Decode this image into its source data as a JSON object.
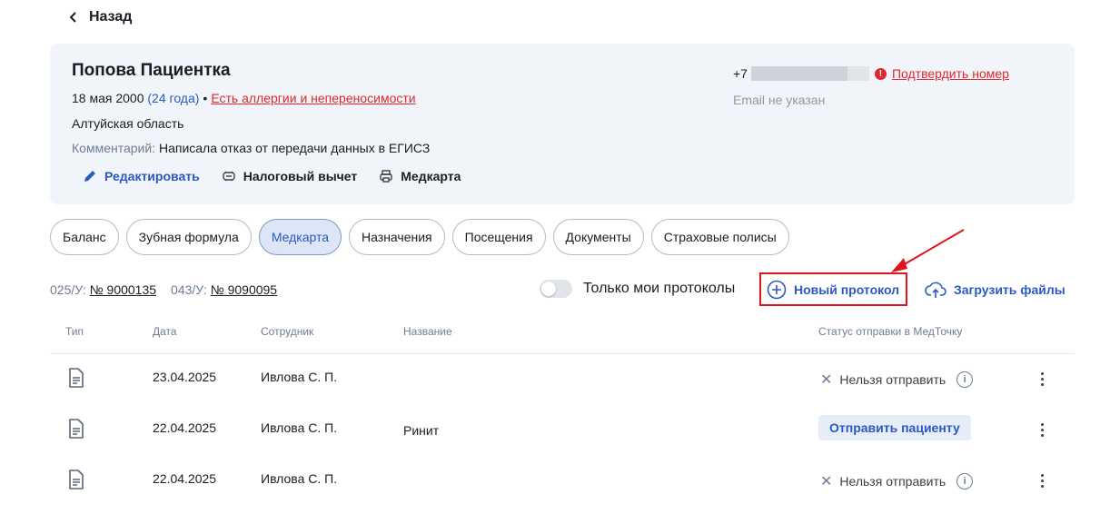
{
  "header": {
    "back_label": "Назад"
  },
  "patient": {
    "name": "Попова Пациентка",
    "dob": "18 мая 2000",
    "age": "(24 года)",
    "allergy_link": "Есть аллергии и непереносимости",
    "region": "Алтуйская область",
    "comment_label": "Комментарий:",
    "comment_text": "Написала отказ от передачи данных в ЕГИСЗ",
    "phone_prefix": "+7",
    "confirm_phone": "Подтвердить номер",
    "email": "Email не указан"
  },
  "card_actions": {
    "edit": "Редактировать",
    "tax": "Налоговый вычет",
    "medcard": "Медкарта"
  },
  "tabs": [
    {
      "label": "Баланс"
    },
    {
      "label": "Зубная формула"
    },
    {
      "label": "Медкарта"
    },
    {
      "label": "Назначения"
    },
    {
      "label": "Посещения"
    },
    {
      "label": "Документы"
    },
    {
      "label": "Страховые полисы"
    }
  ],
  "docs": {
    "f025_code": "025/У:",
    "f025_num": "№ 9000135",
    "f043_code": "043/У:",
    "f043_num": "№ 9090095"
  },
  "toolbar": {
    "only_mine": "Только мои протоколы",
    "new_protocol": "Новый протокол",
    "upload": "Загрузить файлы"
  },
  "table": {
    "headers": {
      "type": "Тип",
      "date": "Дата",
      "employee": "Сотрудник",
      "name": "Название",
      "status": "Статус отправки в МедТочку"
    },
    "rows": [
      {
        "date": "23.04.2025",
        "employee": "Ивлова С. П.",
        "name": "",
        "status": "Нельзя отправить"
      },
      {
        "date": "22.04.2025",
        "employee": "Ивлова С. П.",
        "name": "Ринит",
        "status": "Отправить пациенту"
      },
      {
        "date": "22.04.2025",
        "employee": "Ивлова С. П.",
        "name": "",
        "status": "Нельзя отправить"
      }
    ]
  },
  "colors": {
    "accent": "#2b59c3",
    "danger": "#e0282e",
    "card_bg": "#f1f4f8"
  }
}
